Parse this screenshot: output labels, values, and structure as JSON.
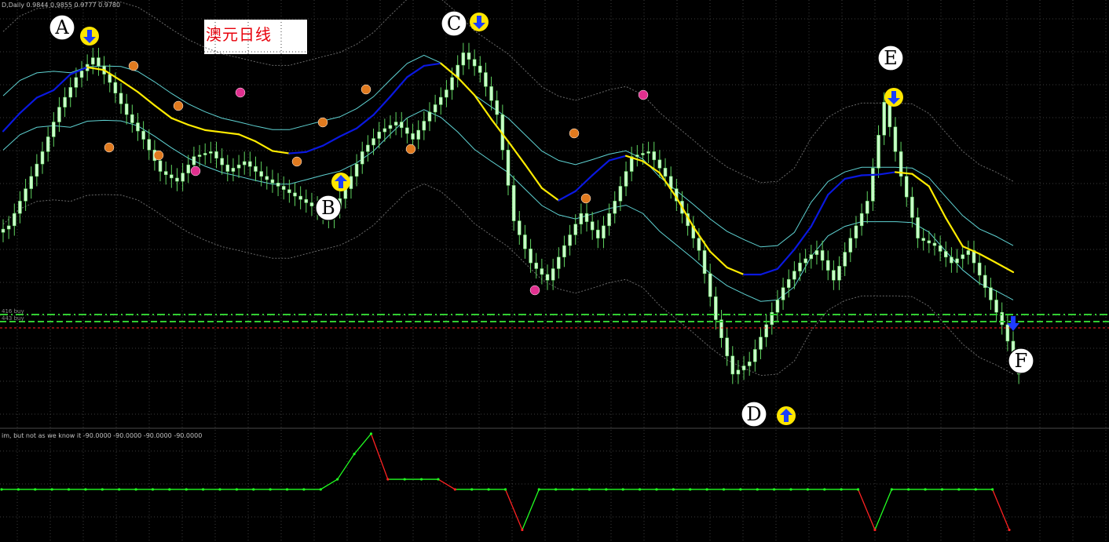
{
  "header": {
    "symbol_info": "D,Daily  0.9844 0.9855 0.9777 0.9780",
    "indicator_info": "im, but not as we know it  -90.0000 -90.0000 -90.0000 -90.0000",
    "level_label_1": "416 buy",
    "level_label_2": "443 buy"
  },
  "title": {
    "text": "澳元日线"
  },
  "annotations": [
    {
      "letter": "A",
      "arrow": "down"
    },
    {
      "letter": "B",
      "arrow": "up"
    },
    {
      "letter": "C",
      "arrow": "down"
    },
    {
      "letter": "D",
      "arrow": "up"
    },
    {
      "letter": "E",
      "arrow": "down"
    },
    {
      "letter": "F",
      "arrow": "down"
    }
  ],
  "colors": {
    "background": "#000000",
    "grid": "#3c3c3c",
    "candle": "#c8ffc8",
    "wick": "#5fd35f",
    "trend_up": "#0a18e0",
    "trend_down": "#ffec00",
    "band_inner": "#5fd3d3",
    "band_outer": "#6a6a6a",
    "level_green": "#32cd32",
    "level_red": "#ff2020",
    "osc_up": "#22ff22",
    "osc_down": "#ff2222"
  },
  "chart_data": [
    {
      "type": "candlestick",
      "title": "澳元日线",
      "overlays": [
        "trend line (blue rising / yellow falling)",
        "envelope bands",
        "horizontal price levels"
      ],
      "price_levels": [
        0.9816,
        0.98,
        0.978
      ],
      "turning_points": [
        {
          "label": "A",
          "index": 5,
          "signal": "sell"
        },
        {
          "label": "B",
          "index": 19,
          "signal": "buy"
        },
        {
          "label": "C",
          "index": 27,
          "signal": "sell"
        },
        {
          "label": "D",
          "index": 43,
          "signal": "buy"
        },
        {
          "label": "E",
          "index": 52,
          "signal": "sell"
        },
        {
          "label": "F",
          "index": 60,
          "signal": "sell"
        }
      ],
      "close": [
        1.0,
        1.015,
        1.03,
        1.048,
        1.06,
        1.068,
        1.058,
        1.045,
        1.035,
        1.022,
        1.018,
        1.028,
        1.03,
        1.022,
        1.026,
        1.02,
        1.016,
        1.012,
        1.008,
        1.003,
        1.015,
        1.03,
        1.038,
        1.042,
        1.035,
        1.046,
        1.055,
        1.07,
        1.062,
        1.045,
        1.002,
        0.985,
        0.978,
        0.992,
        1.005,
        0.995,
        1.01,
        1.028,
        1.03,
        1.02,
        1.005,
        0.99,
        0.962,
        0.94,
        0.945,
        0.96,
        0.975,
        0.985,
        0.99,
        0.978,
        0.995,
        1.01,
        1.05,
        1.02,
        0.995,
        0.992,
        0.985,
        0.99,
        0.975,
        0.96,
        0.94
      ],
      "oscillator": {
        "ylim": [
          -100,
          100
        ],
        "values": [
          -10,
          -10,
          -10,
          -10,
          -10,
          -10,
          -10,
          -10,
          -10,
          -10,
          -10,
          -10,
          -10,
          -10,
          -10,
          -10,
          -10,
          -10,
          -10,
          -10,
          10,
          60,
          100,
          10,
          10,
          10,
          10,
          -10,
          -10,
          -10,
          -10,
          -90,
          -10,
          -10,
          -10,
          -10,
          -10,
          -10,
          -10,
          -10,
          -10,
          -10,
          -10,
          -10,
          -10,
          -10,
          -10,
          -10,
          -10,
          -10,
          -10,
          -10,
          -90,
          -10,
          -10,
          -10,
          -10,
          -10,
          -10,
          -10,
          -90
        ]
      }
    }
  ]
}
